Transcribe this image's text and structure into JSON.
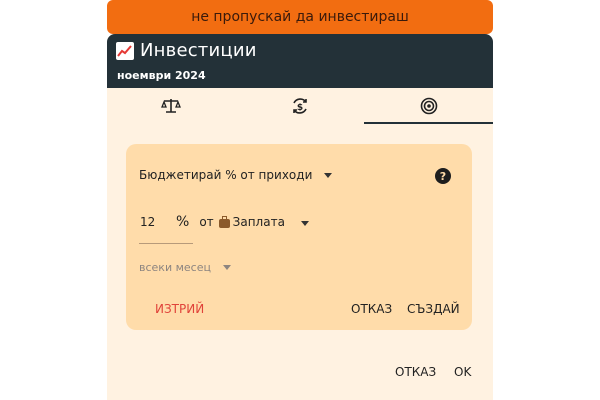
{
  "banner": {
    "text": "не пропускай да инвестираш"
  },
  "header": {
    "title": "Инвестиции",
    "subtitle": "ноември 2024"
  },
  "tabs": [
    {
      "icon": "scale-icon"
    },
    {
      "icon": "currency-exchange-icon"
    },
    {
      "icon": "target-icon",
      "selected": true
    }
  ],
  "form": {
    "budget_type": "Бюджетирай % от приходи",
    "help": "?",
    "amount": "12",
    "percent_sign": "%",
    "from_label": "от",
    "source": "Заплата",
    "frequency": "всеки месец",
    "delete_label": "ИЗТРИЙ",
    "cancel_label": "ОТКАЗ",
    "create_label": "СЪЗДАЙ"
  },
  "footer": {
    "cancel_label": "ОТКАЗ",
    "ok_label": "OK"
  },
  "colors": {
    "banner": "#f26d11",
    "header": "#233138",
    "dialog": "#fff2e1",
    "card": "#ffdcaa",
    "delete": "#e0433a"
  }
}
